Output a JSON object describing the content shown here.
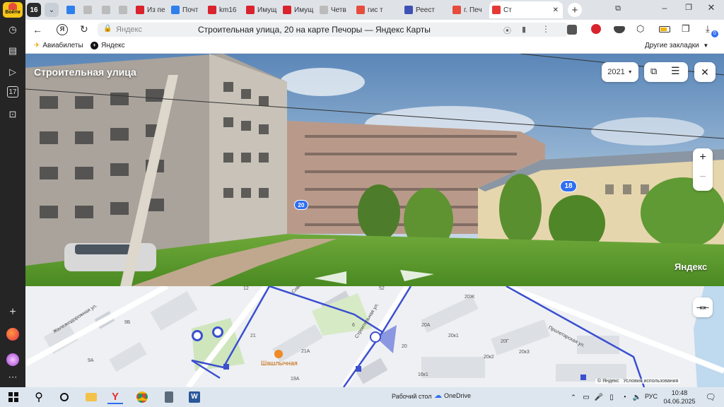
{
  "browser": {
    "yandex_login": "Войти",
    "tab_count": "16",
    "tabs": [
      {
        "label": "",
        "color": "#2f80ed"
      },
      {
        "label": "",
        "color": "#bbb"
      },
      {
        "label": "",
        "color": "#bbb"
      },
      {
        "label": "",
        "color": "#bbb"
      },
      {
        "label": "Из пе",
        "color": "#d9232d"
      },
      {
        "label": "Почт",
        "color": "#2f80ed"
      },
      {
        "label": "km16",
        "color": "#d9232d"
      },
      {
        "label": "Имущ",
        "color": "#d9232d"
      },
      {
        "label": "Имущ",
        "color": "#d9232d"
      },
      {
        "label": "Четв",
        "color": "#bbb"
      },
      {
        "label": "гис т",
        "color": "#e74c3c"
      },
      {
        "label": "Реест",
        "color": "#3f51b5"
      },
      {
        "label": "г. Печ",
        "color": "#e74c3c"
      },
      {
        "label": "Ст",
        "color": "#e53935"
      }
    ],
    "address_site": "Яндекс",
    "page_title": "Строительная улица, 20 на карте Печоры — Яндекс Карты",
    "bookmarks": [
      "Авиабилеты",
      "Яндекс"
    ],
    "other_bookmarks": "Другие закладки",
    "downloads_badge": "0"
  },
  "panorama": {
    "street_name": "Строительная улица",
    "year": "2021",
    "house_labels": [
      "20",
      "18"
    ],
    "watermark": "Яндекс"
  },
  "map": {
    "street_labels": [
      "Железнодорожная ул.",
      "Советская ул.",
      "Строительная ул.",
      "Пролетарская ул."
    ],
    "house_numbers": [
      "9Б",
      "9А",
      "21",
      "21А",
      "20",
      "20А",
      "20к1",
      "20к2",
      "20к3",
      "20Г",
      "20Ж",
      "19А",
      "16к1",
      "12",
      "6",
      "52"
    ],
    "poi_name": "Шашлычная",
    "copyright": "© Яндекс",
    "terms": "Условия использования"
  },
  "taskbar": {
    "desktop_label": "Рабочий стол",
    "onedrive": "OneDrive",
    "language": "РУС",
    "time": "10:48",
    "date": "04.06.2025"
  },
  "colors": {
    "accent_blue": "#2f6ef0",
    "route_line": "#3b4fcf",
    "house_pin": "#2f6ef0"
  }
}
